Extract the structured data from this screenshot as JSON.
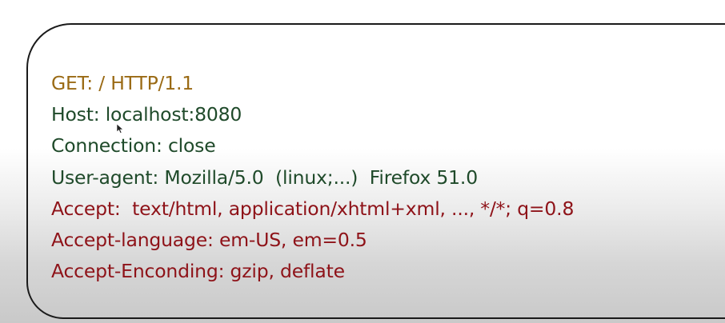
{
  "request": {
    "lines": [
      {
        "text": "GET: / HTTP/1.1",
        "color": "#9a6a14"
      },
      {
        "text": "Host: localhost:8080",
        "color": "#1f4a2a"
      },
      {
        "text": "Connection: close",
        "color": "#1f4a2a"
      },
      {
        "text": "User-agent: Mozilla/5.0  (linux;...)  Firefox 51.0",
        "color": "#1f4a2a"
      },
      {
        "text": "Accept:  text/html, application/xhtml+xml, ..., */*; q=0.8",
        "color": "#8e1218"
      },
      {
        "text": "Accept-language: em-US, em=0.5",
        "color": "#8e1218"
      },
      {
        "text": "Accept-Enconding: gzip, deflate",
        "color": "#8e1218"
      }
    ]
  },
  "pointer": {
    "icon": "mouse-cursor-icon"
  }
}
